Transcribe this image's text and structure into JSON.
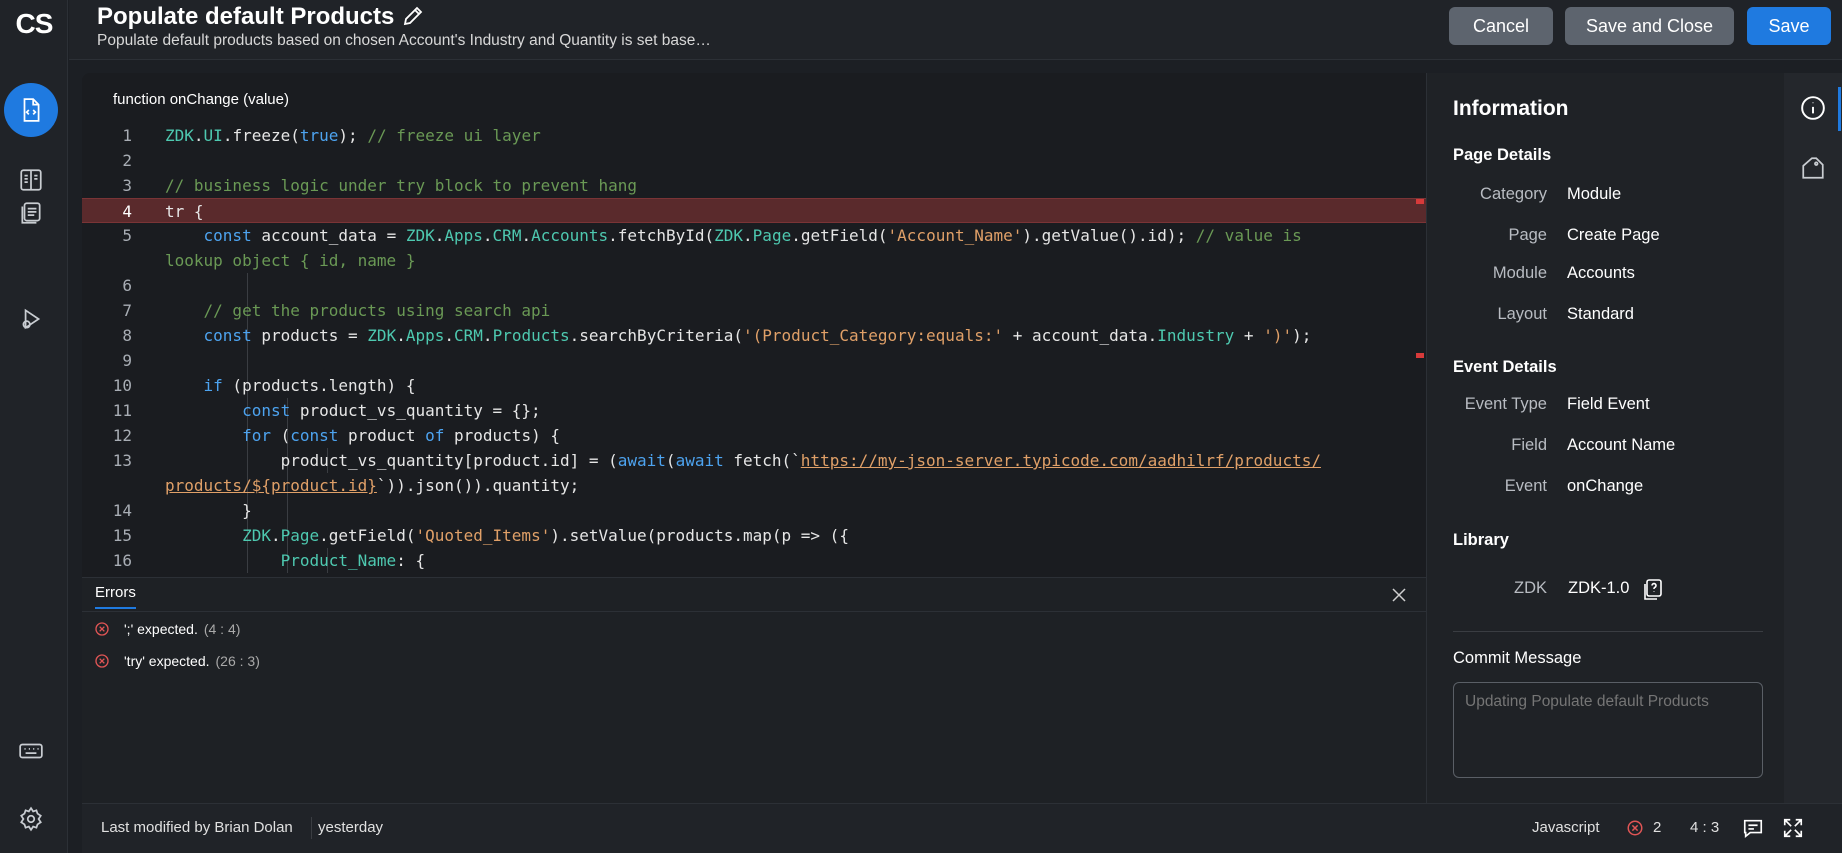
{
  "app": {
    "logo": "CS"
  },
  "header": {
    "title": "Populate default Products",
    "subtitle": "Populate default products based on chosen Account's Industry and Quantity is set base…",
    "cancel_label": "Cancel",
    "save_close_label": "Save and Close",
    "save_label": "Save"
  },
  "editor": {
    "function_label": "function onChange (value)",
    "line_numbers": [
      "1",
      "2",
      "3",
      "4",
      "5",
      "6",
      "7",
      "8",
      "9",
      "10",
      "11",
      "12",
      "13",
      "14",
      "15",
      "16"
    ]
  },
  "errors_panel": {
    "tab_label": "Errors",
    "items": [
      {
        "message": "';' expected.",
        "position": "(4 : 4)"
      },
      {
        "message": "'try' expected.",
        "position": "(26 : 3)"
      }
    ]
  },
  "info": {
    "title": "Information",
    "page_details": {
      "heading": "Page Details",
      "rows": [
        {
          "key": "Category",
          "value": "Module"
        },
        {
          "key": "Page",
          "value": "Create Page"
        },
        {
          "key": "Module",
          "value": "Accounts"
        },
        {
          "key": "Layout",
          "value": "Standard"
        }
      ]
    },
    "event_details": {
      "heading": "Event Details",
      "rows": [
        {
          "key": "Event Type",
          "value": "Field Event"
        },
        {
          "key": "Field",
          "value": "Account Name"
        },
        {
          "key": "Event",
          "value": "onChange"
        }
      ]
    },
    "library": {
      "heading": "Library",
      "key": "ZDK",
      "value": "ZDK-1.0"
    },
    "commit": {
      "heading": "Commit Message",
      "placeholder": "Updating Populate default Products"
    }
  },
  "status_bar": {
    "modified_by": "Last modified by Brian Dolan",
    "modified_when": "yesterday",
    "language": "Javascript",
    "error_count": "2",
    "cursor": "4 : 3"
  },
  "colors": {
    "accent": "#1f7ae0",
    "error": "#d73a3a",
    "error_line_bg": "#5a2a2c"
  }
}
